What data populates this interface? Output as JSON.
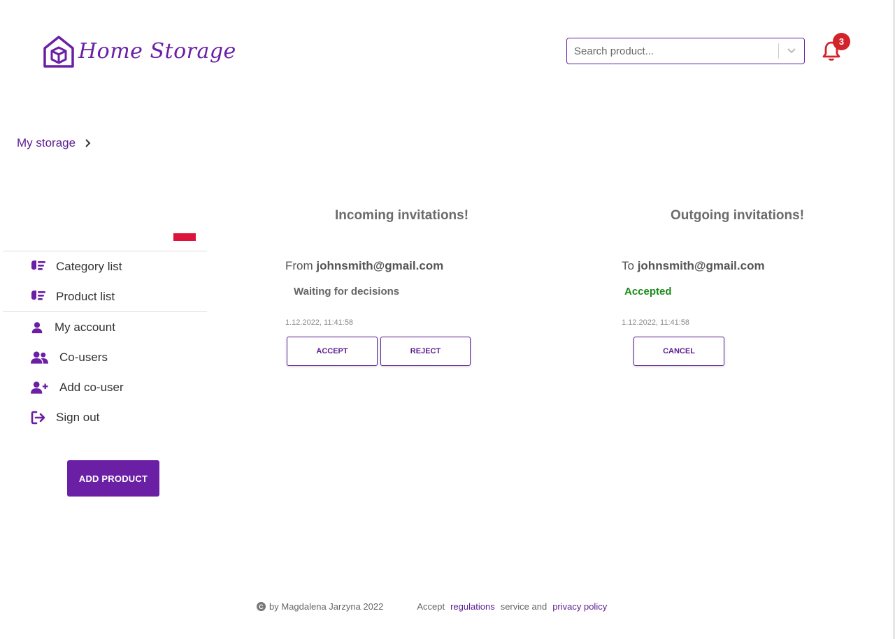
{
  "header": {
    "logo_text": "Home Storage",
    "search": {
      "placeholder": "Search product..."
    },
    "notifications": {
      "count": "3"
    }
  },
  "breadcrumb": {
    "label": "My storage"
  },
  "sidebar": {
    "items": [
      {
        "label": "Category list",
        "icon": "hand-list-icon"
      },
      {
        "label": "Product list",
        "icon": "hand-list-icon"
      },
      {
        "label": "My account",
        "icon": "user-icon"
      },
      {
        "label": "Co-users",
        "icon": "users-icon"
      },
      {
        "label": "Add co-user",
        "icon": "user-plus-icon"
      },
      {
        "label": "Sign out",
        "icon": "sign-out-icon"
      }
    ],
    "add_product_label": "ADD PRODUCT"
  },
  "incoming": {
    "title": "Incoming invitations!",
    "prefix": "From",
    "email": "johnsmith@gmail.com",
    "status": "Waiting for decisions",
    "date": "1.12.2022, 11:41:58",
    "accept_label": "ACCEPT",
    "reject_label": "REJECT"
  },
  "outgoing": {
    "title": "Outgoing invitations!",
    "prefix": "To",
    "email": "johnsmith@gmail.com",
    "status": "Accepted",
    "date": "1.12.2022, 11:41:58",
    "cancel_label": "CANCEL"
  },
  "footer": {
    "copyright_symbol": "C",
    "author": "by Magdalena Jarzyna 2022",
    "accept_text": "Accept",
    "regulations_link": "regulations",
    "service_text": "service and",
    "privacy_link": "privacy policy"
  },
  "colors": {
    "brand": "#6a1fa5",
    "accepted": "#1a8a1a",
    "badge": "#d3222a",
    "flag": "#dc143c"
  }
}
